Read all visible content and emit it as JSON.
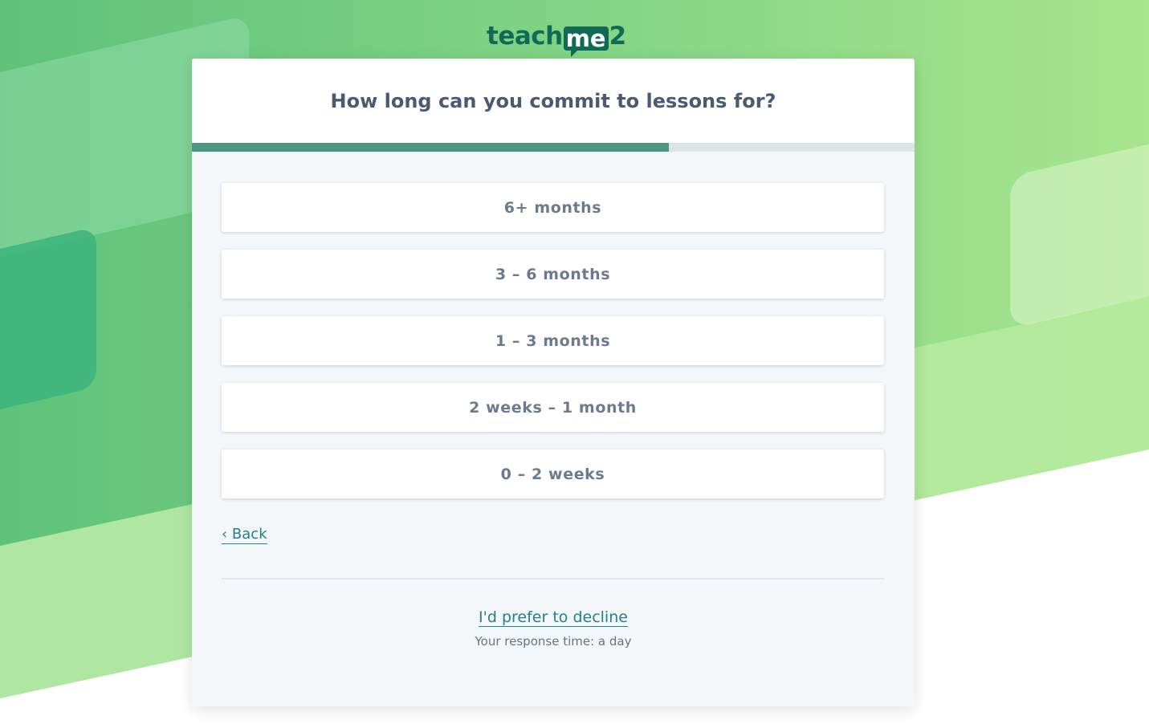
{
  "brand": {
    "logo_prefix": "teach",
    "logo_middle": "me",
    "logo_suffix": "2"
  },
  "colors": {
    "accent": "#22808a",
    "progress_fill": "#4a9785",
    "brand": "#0f6b55"
  },
  "question": "How long can you commit to lessons for?",
  "progress": {
    "fraction": 0.66
  },
  "options": [
    {
      "label": "6+ months"
    },
    {
      "label": "3 – 6 months"
    },
    {
      "label": "1 – 3 months"
    },
    {
      "label": "2 weeks – 1 month"
    },
    {
      "label": "0 – 2 weeks"
    }
  ],
  "back_label": "‹ Back",
  "decline_label": "I'd prefer to decline",
  "response_time": "Your response time: a day"
}
